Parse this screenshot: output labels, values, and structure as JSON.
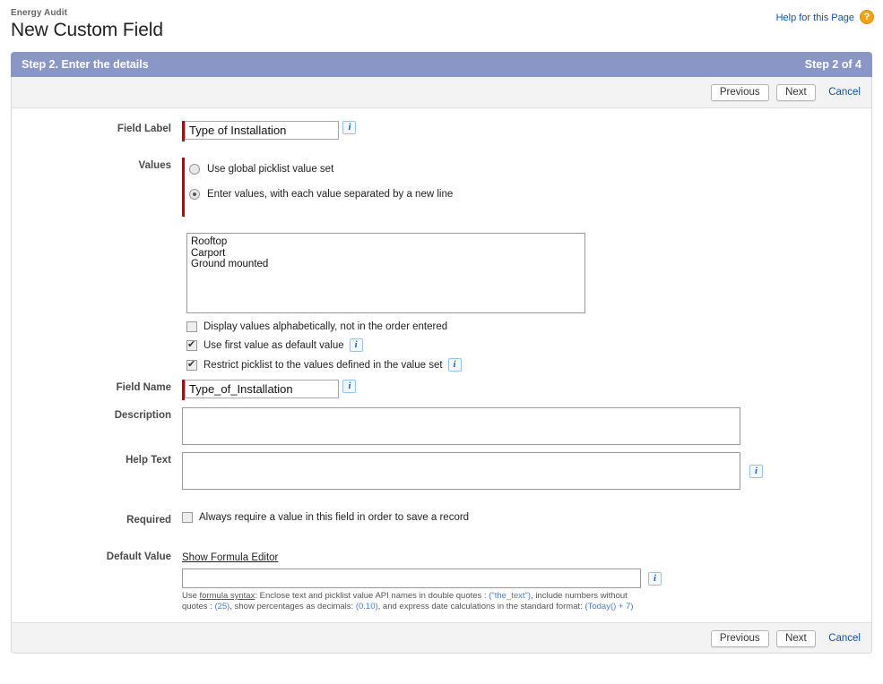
{
  "header": {
    "breadcrumb": "Energy Audit",
    "title": "New Custom Field",
    "help_link": "Help for this Page",
    "help_icon": "question-mark-icon"
  },
  "step_banner": {
    "title": "Step 2. Enter the details",
    "counter": "Step 2 of 4",
    "color": "#8a96c6"
  },
  "actions": {
    "previous": "Previous",
    "next": "Next",
    "cancel": "Cancel"
  },
  "form": {
    "field_label": {
      "label": "Field Label",
      "value": "Type of Installation"
    },
    "values": {
      "label": "Values",
      "option_global": "Use global picklist value set",
      "option_enter": "Enter values, with each value separated by a new line",
      "selected": "enter",
      "textarea_value": "Rooftop\nCarport\nGround mounted",
      "checkbox_alphabetical": "Display values alphabetically, not in the order entered",
      "checkbox_first_default": "Use first value as default value",
      "checkbox_restrict": "Restrict picklist to the values defined in the value set"
    },
    "field_name": {
      "label": "Field Name",
      "value": "Type_of_Installation"
    },
    "description": {
      "label": "Description",
      "value": ""
    },
    "help_text": {
      "label": "Help Text",
      "value": ""
    },
    "required": {
      "label": "Required",
      "checkbox_label": "Always require a value in this field in order to save a record"
    },
    "default_value": {
      "label": "Default Value",
      "formula_link": "Show Formula Editor",
      "value": "",
      "hint_1": "Use ",
      "hint_syntax": "formula syntax",
      "hint_2": ": Enclose text and picklist value API names in double quotes : ",
      "hint_tok_1": "(\"the_text\")",
      "hint_3": ", include numbers without quotes : ",
      "hint_tok_2": "(25)",
      "hint_4": ", show percentages as decimals: ",
      "hint_tok_3": "(0.10)",
      "hint_5": ", and express date calculations in the standard format: ",
      "hint_tok_4": "(Today() + 7)"
    }
  }
}
